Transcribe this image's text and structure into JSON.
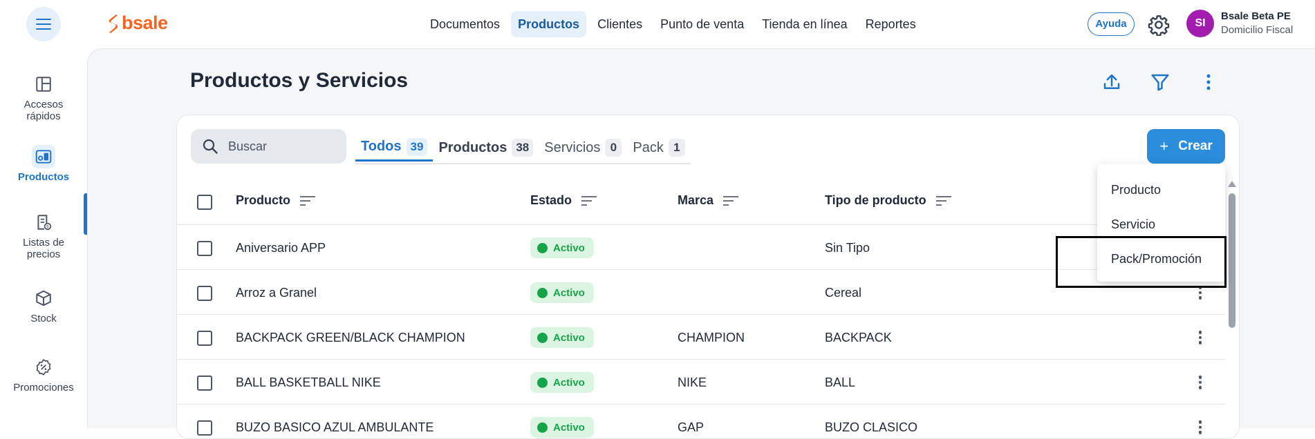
{
  "header": {
    "brand": "bsale",
    "nav": [
      "Documentos",
      "Productos",
      "Clientes",
      "Punto de venta",
      "Tienda en línea",
      "Reportes"
    ],
    "nav_active": "Productos",
    "help_label": "Ayuda",
    "avatar_initials": "SI",
    "user_name": "Bsale Beta PE",
    "user_sub": "Domicilio Fiscal"
  },
  "sidebar": {
    "items": [
      {
        "label_line1": "Accesos",
        "label_line2": "rápidos",
        "icon": "layout-icon"
      },
      {
        "label_line1": "Productos",
        "label_line2": "",
        "icon": "products-icon",
        "active": true
      },
      {
        "label_line1": "Listas de",
        "label_line2": "precios",
        "icon": "price-list-icon"
      },
      {
        "label_line1": "Stock",
        "label_line2": "",
        "icon": "box-icon"
      },
      {
        "label_line1": "Promociones",
        "label_line2": "",
        "icon": "promo-icon"
      }
    ]
  },
  "page": {
    "title": "Productos y Servicios"
  },
  "search": {
    "placeholder": "Buscar"
  },
  "tabs": [
    {
      "label": "Todos",
      "count": "39"
    },
    {
      "label": "Productos",
      "count": "38"
    },
    {
      "label": "Servicios",
      "count": "0"
    },
    {
      "label": "Pack",
      "count": "1"
    }
  ],
  "create_button": "Crear",
  "dropdown": [
    "Producto",
    "Servicio",
    "Pack/Promoción"
  ],
  "table": {
    "columns": [
      "Producto",
      "Estado",
      "Marca",
      "Tipo de producto"
    ],
    "rows": [
      {
        "producto": "Aniversario APP",
        "estado": "Activo",
        "marca": "",
        "tipo": "Sin Tipo"
      },
      {
        "producto": "Arroz a Granel",
        "estado": "Activo",
        "marca": "",
        "tipo": "Cereal"
      },
      {
        "producto": "BACKPACK GREEN/BLACK CHAMPION",
        "estado": "Activo",
        "marca": "CHAMPION",
        "tipo": "BACKPACK"
      },
      {
        "producto": "BALL BASKETBALL NIKE",
        "estado": "Activo",
        "marca": "NIKE",
        "tipo": "BALL"
      },
      {
        "producto": "BUZO BASICO AZUL AMBULANTE",
        "estado": "Activo",
        "marca": "GAP",
        "tipo": "BUZO CLASICO"
      }
    ]
  },
  "colors": {
    "primary": "#1f73c9",
    "brand": "#f26522",
    "success": "#16a34a"
  }
}
